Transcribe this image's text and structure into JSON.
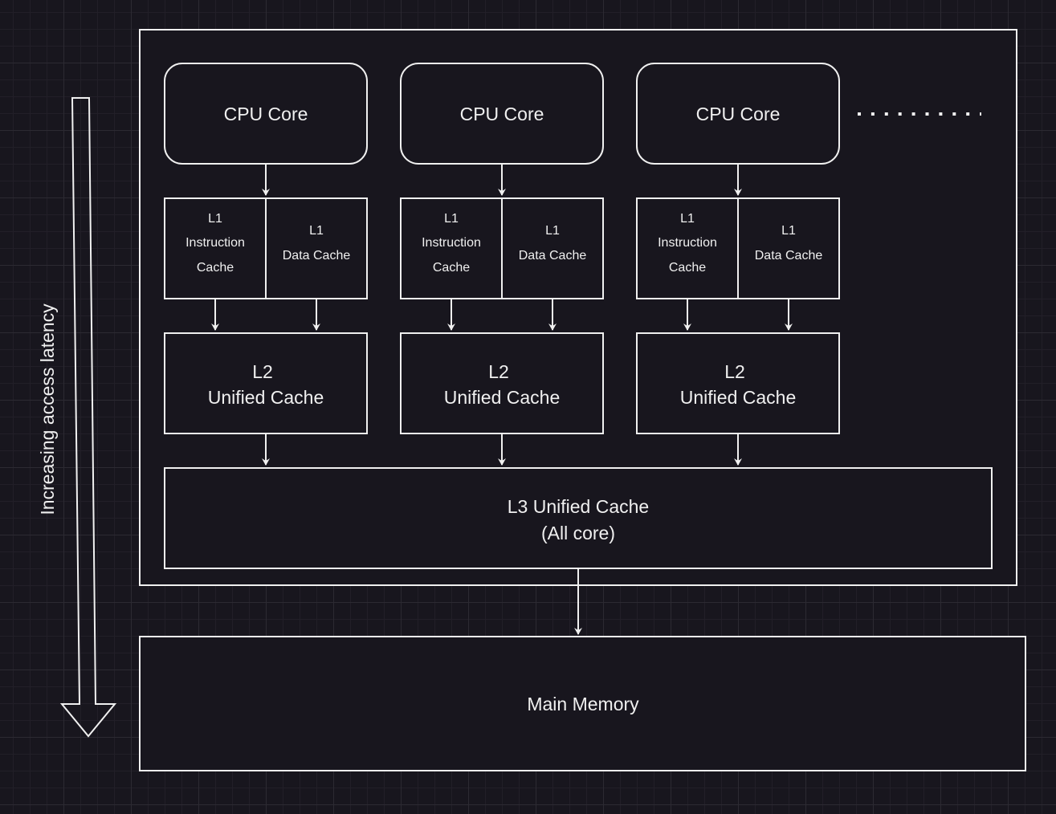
{
  "diagram": {
    "latency_label": "Increasing access latency",
    "cores": [
      {
        "cpu": "CPU Core",
        "l1i": [
          "L1",
          "Instruction",
          "Cache"
        ],
        "l1d": [
          "L1",
          "Data Cache"
        ],
        "l2": [
          "L2",
          "Unified Cache"
        ]
      },
      {
        "cpu": "CPU Core",
        "l1i": [
          "L1",
          "Instruction",
          "Cache"
        ],
        "l1d": [
          "L1",
          "Data Cache"
        ],
        "l2": [
          "L2",
          "Unified Cache"
        ]
      },
      {
        "cpu": "CPU Core",
        "l1i": [
          "L1",
          "Instruction",
          "Cache"
        ],
        "l1d": [
          "L1",
          "Data Cache"
        ],
        "l2": [
          "L2",
          "Unified Cache"
        ]
      }
    ],
    "l3": [
      "L3 Unified Cache",
      "(All core)"
    ],
    "main_memory": "Main Memory",
    "colors": {
      "background": "#18161e",
      "stroke": "#f0f0f0"
    }
  }
}
